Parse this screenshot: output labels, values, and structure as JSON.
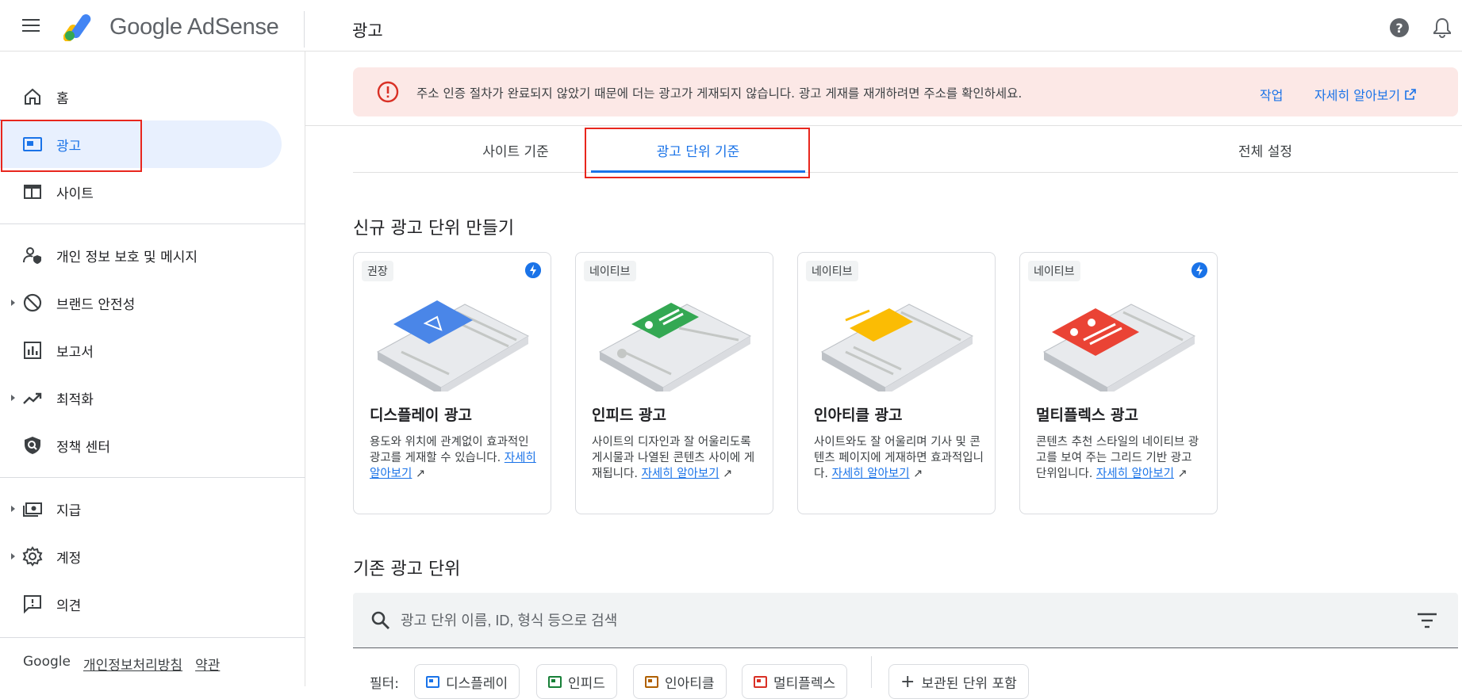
{
  "header": {
    "app_name": "Google AdSense",
    "page_title": "광고",
    "help_icon": "help-circle-icon",
    "notification_icon": "bell-icon"
  },
  "sidebar": {
    "items": [
      {
        "label": "홈",
        "icon": "home-icon"
      },
      {
        "label": "광고",
        "icon": "ad-unit-icon",
        "active": true
      },
      {
        "label": "사이트",
        "icon": "web-icon"
      },
      {
        "label": "개인 정보 보호 및 메시지",
        "icon": "privacy-icon"
      },
      {
        "label": "브랜드 안전성",
        "icon": "block-icon"
      },
      {
        "label": "보고서",
        "icon": "bar-chart-icon"
      },
      {
        "label": "최적화",
        "icon": "trending-up-icon"
      },
      {
        "label": "정책 센터",
        "icon": "policy-shield-icon"
      },
      {
        "label": "지급",
        "icon": "payments-icon"
      },
      {
        "label": "계정",
        "icon": "gear-icon"
      },
      {
        "label": "의견",
        "icon": "feedback-icon"
      }
    ],
    "footer": {
      "brand": "Google",
      "privacy": "개인정보처리방침",
      "terms": "약관"
    }
  },
  "alert": {
    "message": "주소 인증 절차가 완료되지 않았기 때문에 더는 광고가 게재되지 않습니다. 광고 게재를 재개하려면 주소를 확인하세요.",
    "action": "작업",
    "learn_more": "자세히 알아보기"
  },
  "tabs": [
    {
      "label": "사이트 기준"
    },
    {
      "label": "광고 단위 기준",
      "active": true
    },
    {
      "label": "전체 설정"
    }
  ],
  "new_section": {
    "title": "신규 광고 단위 만들기",
    "cards": [
      {
        "badge": "권장",
        "title": "디스플레이 광고",
        "desc": "용도와 위치에 관계없이 효과적인 광고를 게재할 수 있습니다.",
        "link": "자세히 알아보기",
        "bolt": true,
        "color": "#4a86e8"
      },
      {
        "badge": "네이티브",
        "title": "인피드 광고",
        "desc": "사이트의 디자인과 잘 어울리도록 게시물과 나열된 콘텐츠 사이에 게재됩니다.",
        "link": "자세히 알아보기",
        "bolt": false,
        "color": "#34a853"
      },
      {
        "badge": "네이티브",
        "title": "인아티클 광고",
        "desc": "사이트와도 잘 어울리며 기사 및 콘텐츠 페이지에 게재하면 효과적입니다.",
        "link": "자세히 알아보기",
        "bolt": false,
        "color": "#fbbc04"
      },
      {
        "badge": "네이티브",
        "title": "멀티플렉스 광고",
        "desc": "콘텐츠 추천 스타일의 네이티브 광고를 보여 주는 그리드 기반 광고 단위입니다.",
        "link": "자세히 알아보기",
        "bolt": true,
        "color": "#ea4335"
      }
    ]
  },
  "existing_section": {
    "title": "기존 광고 단위",
    "search_placeholder": "광고 단위 이름, ID, 형식 등으로 검색",
    "filter_label": "필터:",
    "chips": [
      {
        "label": "디스플레이",
        "color": "#1a73e8"
      },
      {
        "label": "인피드",
        "color": "#188038"
      },
      {
        "label": "인아티클",
        "color": "#b06000"
      },
      {
        "label": "멀티플렉스",
        "color": "#d93025"
      }
    ],
    "archived_label": "보관된 단위 포함"
  }
}
